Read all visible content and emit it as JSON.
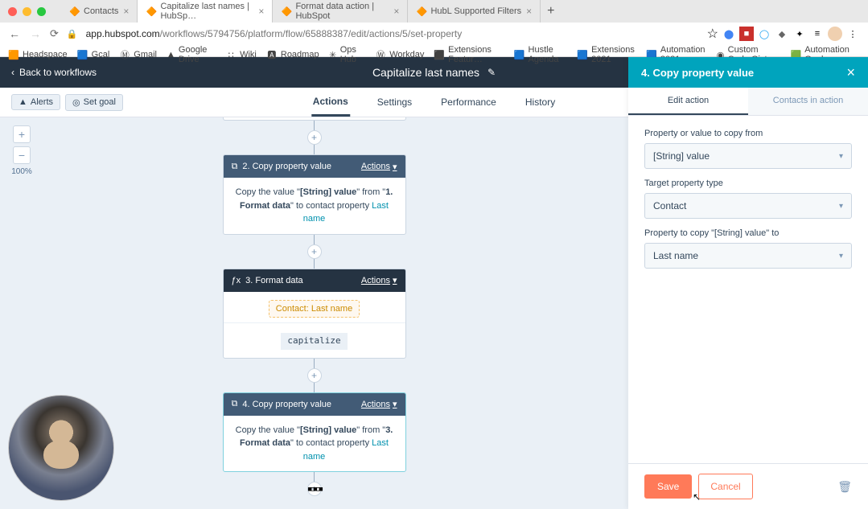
{
  "browser": {
    "tabs": [
      {
        "label": "Contacts",
        "favicon": "hubspot"
      },
      {
        "label": "Capitalize last names | HubSp…",
        "favicon": "hubspot",
        "active": true
      },
      {
        "label": "Format data action | HubSpot",
        "favicon": "hubspot"
      },
      {
        "label": "HubL Supported Filters",
        "favicon": "hubspot"
      }
    ],
    "url_domain": "app.hubspot.com",
    "url_path": "/workflows/5794756/platform/flow/65888387/edit/actions/5/set-property",
    "bookmarks": [
      "Headspace",
      "Gcal",
      "Gmail",
      "Google Drive",
      "Wiki",
      "Roadmap",
      "Ops Hub",
      "Workday",
      "Extensions Featur…",
      "Hustle Agenda",
      "Extensions 2021",
      "Automation 2021",
      "Custom Code Gist",
      "Automation Goals…"
    ]
  },
  "header": {
    "back_label": "Back to workflows",
    "title": "Capitalize last names"
  },
  "subheader": {
    "alerts_label": "Alerts",
    "goal_label": "Set goal",
    "tabs": [
      "Actions",
      "Settings",
      "Performance",
      "History"
    ],
    "active_tab": "Actions"
  },
  "zoom": {
    "percent": "100%"
  },
  "nodes": {
    "n2": {
      "title": "2. Copy property value",
      "actions_label": "Actions",
      "body_pre": "Copy the value \"",
      "body_val": "[String] value",
      "body_mid": "\" from \"",
      "body_src": "1. Format data",
      "body_mid2": "\" to contact property ",
      "body_link": "Last name"
    },
    "n3": {
      "title": "3. Format data",
      "actions_label": "Actions",
      "pill": "Contact: Last name",
      "code": "capitalize"
    },
    "n4": {
      "title": "4. Copy property value",
      "actions_label": "Actions",
      "body_pre": "Copy the value \"",
      "body_val": "[String] value",
      "body_mid": "\" from \"",
      "body_src": "3. Format data",
      "body_mid2": "\" to contact property ",
      "body_link": "Last name"
    }
  },
  "panel": {
    "title": "4. Copy property value",
    "tab_edit": "Edit action",
    "tab_contacts": "Contacts in action",
    "f1_label": "Property or value to copy from",
    "f1_value": "[String] value",
    "f2_label": "Target property type",
    "f2_value": "Contact",
    "f3_label": "Property to copy \"[String] value\" to",
    "f3_value": "Last name",
    "save": "Save",
    "cancel": "Cancel"
  }
}
